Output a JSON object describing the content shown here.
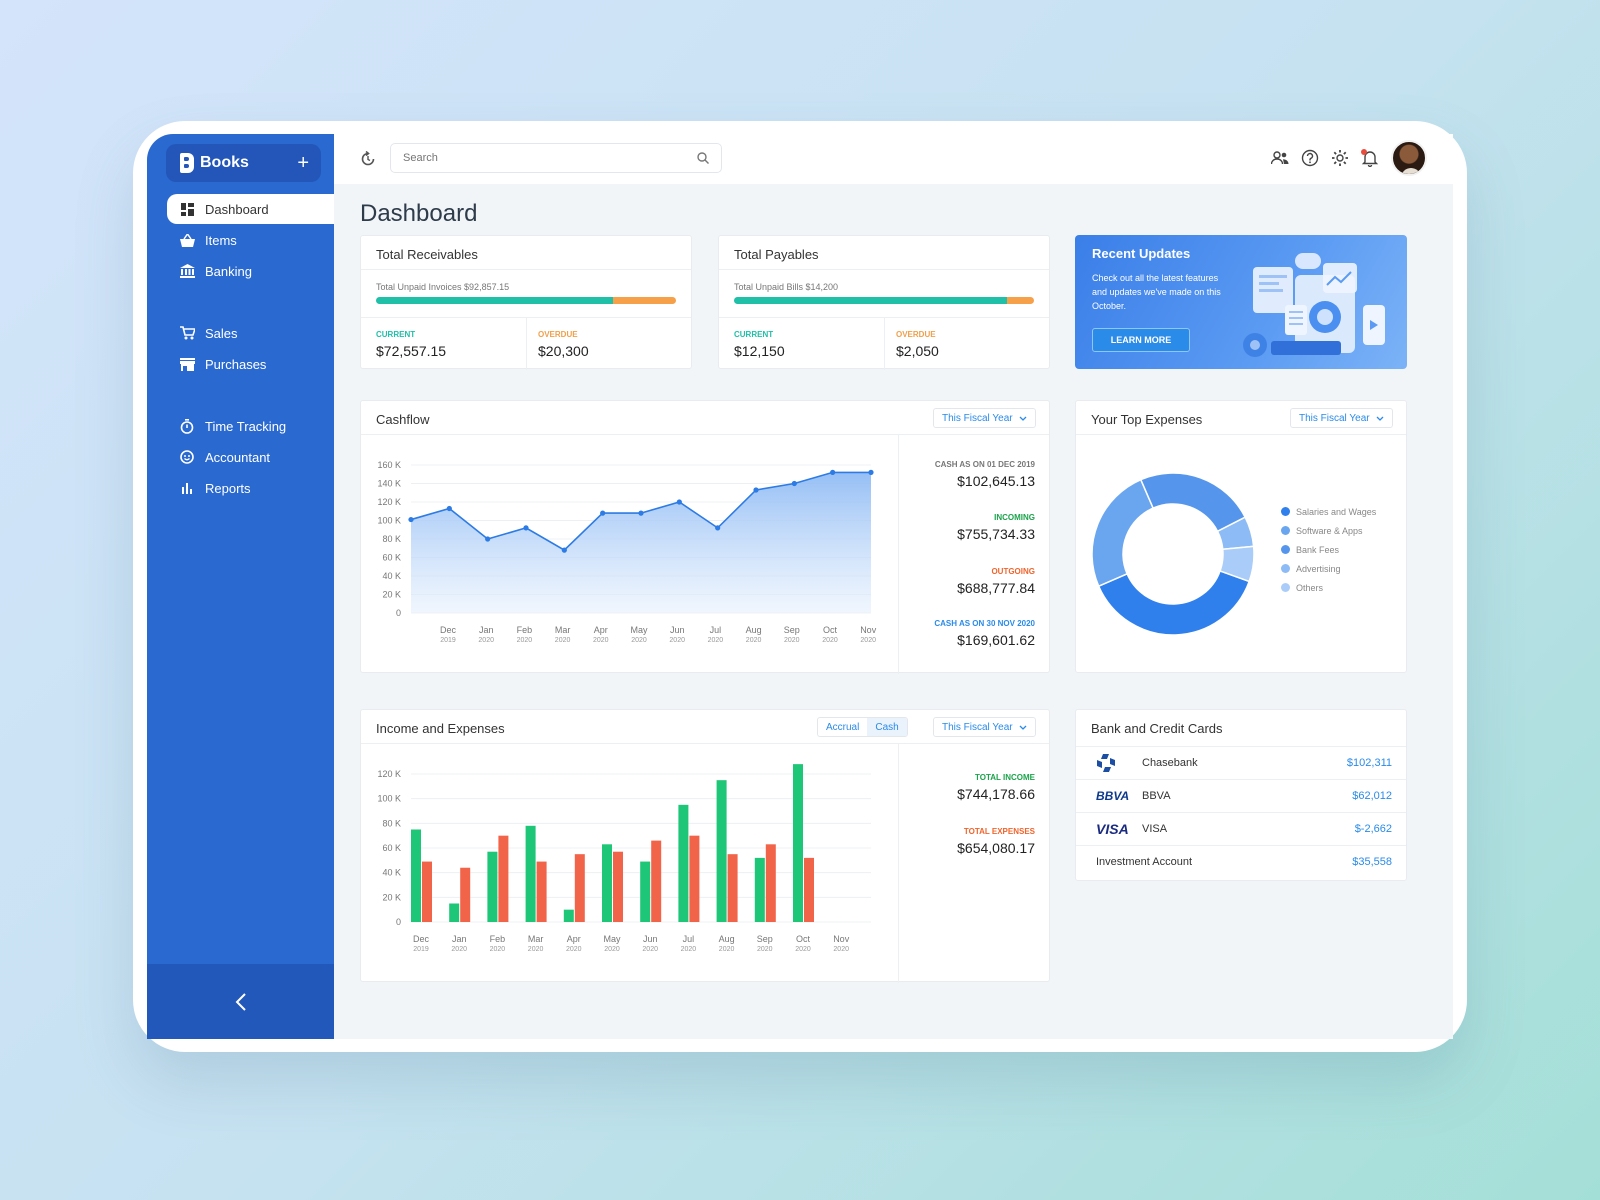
{
  "app": {
    "name": "Books"
  },
  "sidebar": {
    "items": [
      {
        "label": "Dashboard",
        "icon": "dashboard-icon",
        "active": true
      },
      {
        "label": "Items",
        "icon": "basket-icon"
      },
      {
        "label": "Banking",
        "icon": "bank-icon"
      },
      {
        "label": "Sales",
        "icon": "cart-icon"
      },
      {
        "label": "Purchases",
        "icon": "store-icon"
      },
      {
        "label": "Time Tracking",
        "icon": "stopwatch-icon"
      },
      {
        "label": "Accountant",
        "icon": "smile-icon"
      },
      {
        "label": "Reports",
        "icon": "bar-chart-icon"
      }
    ]
  },
  "search": {
    "placeholder": "Search"
  },
  "page": {
    "title": "Dashboard"
  },
  "receivables": {
    "title": "Total Receivables",
    "subtitle": "Total Unpaid Invoices $92,857.15",
    "current_label": "CURRENT",
    "current_value": "$72,557.15",
    "overdue_label": "OVERDUE",
    "overdue_value": "$20,300",
    "current_fraction": 0.79
  },
  "payables": {
    "title": "Total Payables",
    "subtitle": "Total Unpaid Bills $14,200",
    "current_label": "CURRENT",
    "current_value": "$12,150",
    "overdue_label": "OVERDUE",
    "overdue_value": "$2,050",
    "current_fraction": 0.91
  },
  "updates": {
    "title": "Recent Updates",
    "text": "Check out all the latest features and updates we've made on this October.",
    "button": "LEARN MORE"
  },
  "cashflow": {
    "title": "Cashflow",
    "period": "This Fiscal Year",
    "stats": [
      {
        "label": "CASH AS ON 01 DEC 2019",
        "value": "$102,645.13",
        "color": "#777777"
      },
      {
        "label": "INCOMING",
        "value": "$755,734.33",
        "color": "#1aa34a"
      },
      {
        "label": "OUTGOING",
        "value": "$688,777.84",
        "color": "#f0642d"
      },
      {
        "label": "CASH AS ON 30 NOV 2020",
        "value": "$169,601.62",
        "color": "#2a8be8"
      }
    ]
  },
  "income_expenses": {
    "title": "Income and Expenses",
    "toggle": [
      "Accrual",
      "Cash"
    ],
    "period": "This Fiscal Year",
    "total_income_label": "TOTAL INCOME",
    "total_income": "$744,178.66",
    "total_expenses_label": "TOTAL EXPENSES",
    "total_expenses": "$654,080.17"
  },
  "top_expenses": {
    "title": "Your Top Expenses",
    "period": "This Fiscal Year",
    "legend": [
      "Salaries and Wages",
      "Software & Apps",
      "Bank Fees",
      "Advertising",
      "Others"
    ]
  },
  "banks": {
    "title": "Bank and Credit Cards",
    "rows": [
      {
        "name": "Chasebank",
        "value": "$102,311",
        "logo": "chase-logo"
      },
      {
        "name": "BBVA",
        "value": "$62,012",
        "logo": "BBVA"
      },
      {
        "name": "VISA",
        "value": "$-2,662",
        "logo": "VISA"
      },
      {
        "name": "Investment Account",
        "value": "$35,558",
        "logo": ""
      }
    ]
  },
  "colors": {
    "accent": "#2a69d0",
    "income": "#1ec677",
    "expense": "#f2644a",
    "line": "#2d7be4"
  },
  "chart_data": [
    {
      "type": "area",
      "categories": [
        "Dec 2019",
        "Jan 2020",
        "Feb 2020",
        "Mar 2020",
        "Apr 2020",
        "May 2020",
        "Jun 2020",
        "Jul 2020",
        "Aug 2020",
        "Sep 2020",
        "Oct 2020",
        "Nov 2020"
      ],
      "x_labels_top": [
        "Dec",
        "Jan",
        "Feb",
        "Mar",
        "Apr",
        "May",
        "Jun",
        "Jul",
        "Aug",
        "Sep",
        "Oct",
        "Nov"
      ],
      "x_labels_bottom": [
        "2019",
        "2020",
        "2020",
        "2020",
        "2020",
        "2020",
        "2020",
        "2020",
        "2020",
        "2020",
        "2020",
        "2020"
      ],
      "values_k": [
        101,
        113,
        80,
        92,
        68,
        108,
        108,
        120,
        92,
        133,
        140,
        152,
        152
      ],
      "ylim": [
        0,
        160
      ],
      "yticks": [
        "0",
        "20 K",
        "40 K",
        "60 K",
        "80 K",
        "100 K",
        "120 K",
        "140 K",
        "160 K"
      ],
      "grid": true
    },
    {
      "type": "bar",
      "categories": [
        "Dec 2019",
        "Jan 2020",
        "Feb 2020",
        "Mar 2020",
        "Apr 2020",
        "May 2020",
        "Jun 2020",
        "Jul 2020",
        "Aug 2020",
        "Sep 2020",
        "Oct 2020",
        "Nov 2020"
      ],
      "x_labels_top": [
        "Dec",
        "Jan",
        "Feb",
        "Mar",
        "Apr",
        "May",
        "Jun",
        "Jul",
        "Aug",
        "Sep",
        "Oct",
        "Nov"
      ],
      "x_labels_bottom": [
        "2019",
        "2020",
        "2020",
        "2020",
        "2020",
        "2020",
        "2020",
        "2020",
        "2020",
        "2020",
        "2020",
        "2020"
      ],
      "series": [
        {
          "values_k": [
            75,
            15,
            57,
            78,
            10,
            63,
            49,
            95,
            115,
            52,
            128,
            0
          ]
        },
        {
          "values_k": [
            49,
            44,
            70,
            49,
            55,
            57,
            66,
            70,
            55,
            63,
            52,
            0
          ]
        }
      ],
      "ylim": [
        0,
        120
      ],
      "yticks": [
        "0",
        "20 K",
        "40 K",
        "60 K",
        "80 K",
        "100 K",
        "120 K"
      ],
      "grid": true
    },
    {
      "type": "pie",
      "labels": [
        "Salaries and Wages",
        "Software & Apps",
        "Bank Fees",
        "Advertising",
        "Others"
      ],
      "values": [
        38,
        25,
        24,
        6,
        7
      ],
      "colors": [
        "#2f80ed",
        "#6aa6f0",
        "#5596ec",
        "#8dbbf5",
        "#a9cdf8"
      ]
    }
  ]
}
